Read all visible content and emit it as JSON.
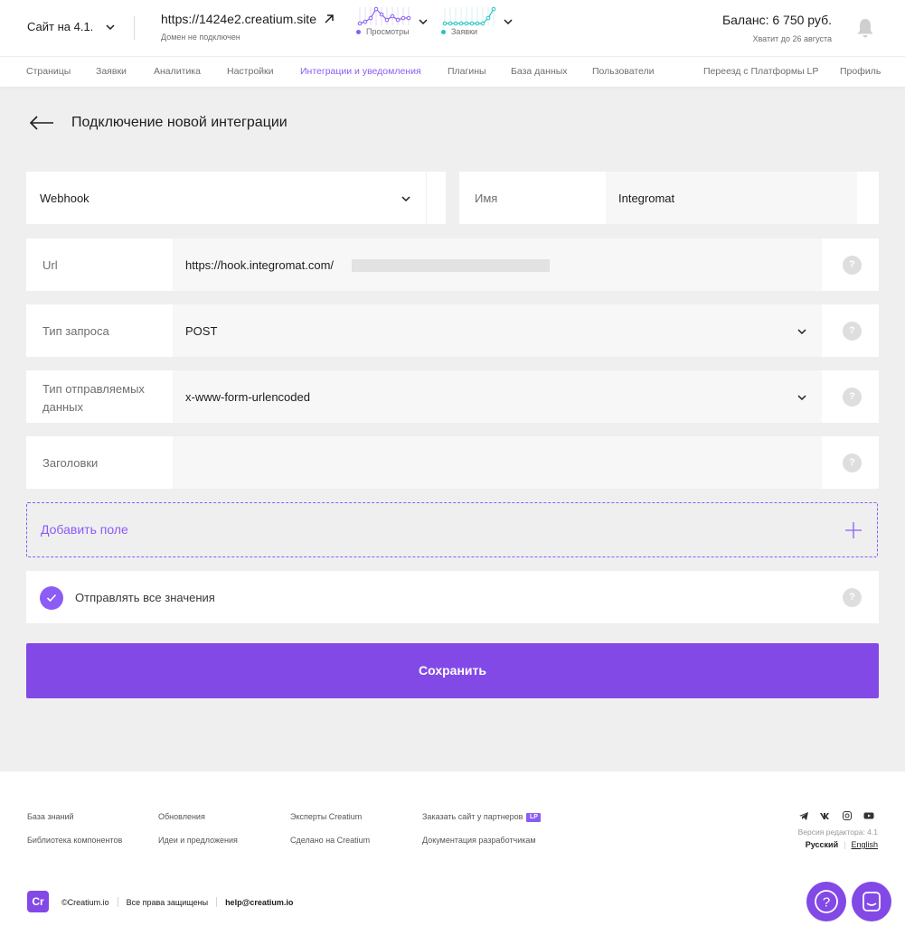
{
  "header": {
    "site_name": "Сайт на 4.1.",
    "domain_url": "https://1424e2.creatium.site",
    "domain_status": "Домен не подключен",
    "stats": [
      {
        "legend": "Просмотры",
        "color": "#8b5cf6"
      },
      {
        "legend": "Заявки",
        "color": "#22c3c3"
      }
    ],
    "balance": "Баланс: 6 750 руб.",
    "balance_note": "Хватит до 26 августа"
  },
  "nav": {
    "items": [
      {
        "label": "Страницы"
      },
      {
        "label": "Заявки"
      },
      {
        "label": "Аналитика"
      },
      {
        "label": "Настройки"
      },
      {
        "label": "Интеграции и уведомления",
        "active": true
      },
      {
        "label": "Плагины"
      },
      {
        "label": "База данных"
      },
      {
        "label": "Пользователи"
      },
      {
        "label": "Переезд с Платформы LP"
      },
      {
        "label": "Профиль"
      }
    ]
  },
  "page": {
    "title": "Подключение новой интеграции"
  },
  "form": {
    "integration_type": "Webhook",
    "name_label": "Имя",
    "name_value": "Integromat",
    "url_label": "Url",
    "url_value": "https://hook.integromat.com/",
    "request_type_label": "Тип запроса",
    "request_type_value": "POST",
    "data_type_label_1": "Тип отправляемых",
    "data_type_label_2": "данных",
    "data_type_value": "x-www-form-urlencoded",
    "headers_label": "Заголовки",
    "headers_value": "",
    "help_mark": "?",
    "add_field": "Добавить поле",
    "send_all_label": "Отправлять все значения",
    "send_all_checked": true,
    "save": "Сохранить"
  },
  "footer": {
    "links_col1": [
      "База знаний",
      "Библиотека компонентов"
    ],
    "links_col2": [
      "Обновления",
      "Идеи и предложения"
    ],
    "links_col3": [
      "Эксперты Creatium",
      "Сделано на Creatium"
    ],
    "links_col4": [
      "Заказать сайт у партнеров",
      "Документация разработчикам"
    ],
    "lp_badge": "LP",
    "social_icons": [
      "telegram-icon",
      "vk-icon",
      "instagram-icon",
      "youtube-icon"
    ],
    "version": "Версия редактора: 4.1",
    "lang_ru": "Русский",
    "lang_en": "English",
    "logo_text": "Cr",
    "copyright": "©Creatium.io",
    "rights": "Все права защищены",
    "email": "help@creatium.io",
    "help_button": "?"
  }
}
